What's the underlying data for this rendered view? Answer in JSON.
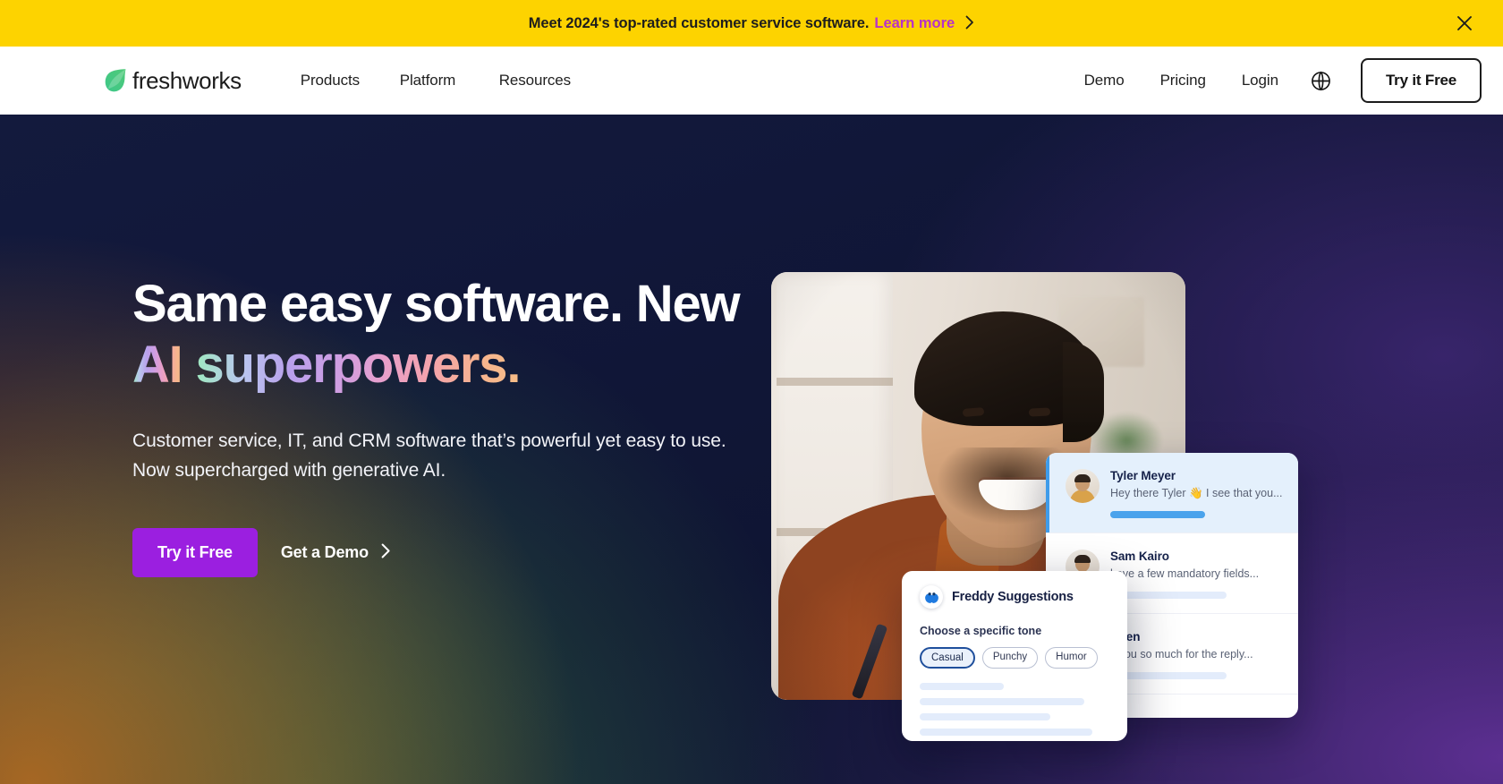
{
  "banner": {
    "text": "Meet 2024's top-rated customer service software.",
    "link_label": "Learn more",
    "close_label": "Close banner",
    "bg_color": "#fdd300",
    "link_color": "#b832c8"
  },
  "nav": {
    "brand": "freshworks",
    "brand_icon": "freshworks-leaf-logo",
    "links": [
      {
        "label": "Products"
      },
      {
        "label": "Platform"
      },
      {
        "label": "Resources"
      }
    ],
    "right_links": [
      {
        "label": "Demo"
      },
      {
        "label": "Pricing"
      },
      {
        "label": "Login"
      }
    ],
    "language_icon": "globe-icon",
    "cta_label": "Try it Free"
  },
  "hero": {
    "headline_line1": "Same easy software. New",
    "headline_ai": "AI",
    "headline_gradient": "superpowers.",
    "subhead": "Customer service, IT, and CRM software that’s powerful yet easy to use. Now supercharged with generative AI.",
    "primary_cta": "Try it Free",
    "secondary_cta": "Get a Demo",
    "primary_cta_color": "#9b1fe0"
  },
  "artwork": {
    "photo_alt": "smiling-support-agent-photo",
    "conversations": [
      {
        "name": "Tyler Meyer",
        "snippet": "Hey there Tyler 👋 I see that you...",
        "active": true
      },
      {
        "name": "Sam Kairo",
        "snippet": "have a few mandatory fields...",
        "active": false
      },
      {
        "name": "Chen",
        "snippet": "k you so much for the reply...",
        "active": false
      }
    ],
    "freddy": {
      "icon": "freddy-bot-icon",
      "title": "Freddy Suggestions",
      "tone_label": "Choose a specific tone",
      "tones": [
        {
          "label": "Casual",
          "selected": true
        },
        {
          "label": "Punchy",
          "selected": false
        },
        {
          "label": "Humor",
          "selected": false
        }
      ],
      "skeleton_widths": [
        "44%",
        "82%",
        "66%",
        "88%"
      ]
    }
  }
}
